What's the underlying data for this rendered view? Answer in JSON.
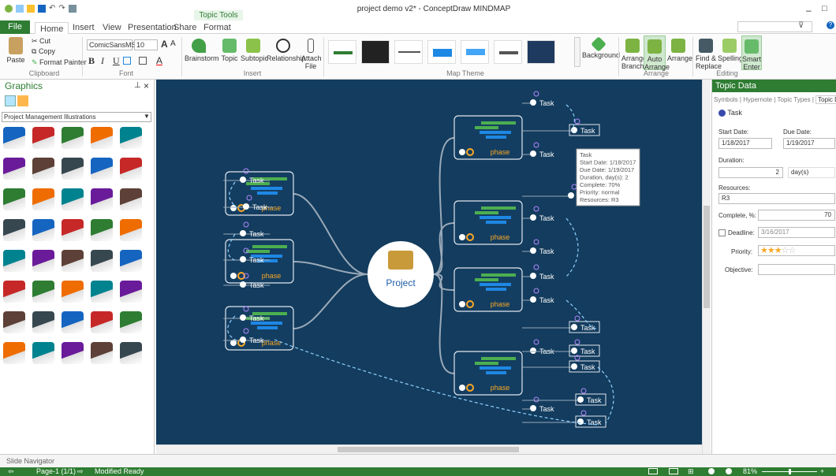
{
  "window": {
    "title": "project demo v2* - ConceptDraw MINDMAP",
    "context_tab": "Topic Tools",
    "search_value": "",
    "controls": [
      "–",
      "□"
    ]
  },
  "tabs": [
    {
      "id": "file",
      "label": "File"
    },
    {
      "id": "home",
      "label": "Home"
    },
    {
      "id": "insert",
      "label": "Insert"
    },
    {
      "id": "view",
      "label": "View"
    },
    {
      "id": "presentation",
      "label": "Presentation"
    },
    {
      "id": "share",
      "label": "Share"
    },
    {
      "id": "format",
      "label": "Format"
    }
  ],
  "ribbon": {
    "clipboard": {
      "paste": "Paste",
      "cut": "Cut",
      "copy": "Copy",
      "format_painter": "Format Painter",
      "label": "Clipboard"
    },
    "font": {
      "family": "ComicSansMS",
      "size": "10",
      "label": "Font",
      "bold": "B",
      "italic": "I",
      "underline": "U",
      "grow": "A",
      "shrink": "A"
    },
    "insert": {
      "brainstorm": "Brainstorm",
      "topic": "Topic",
      "subtopic": "Subtopic",
      "relationship": "Relationship",
      "attach": "Attach",
      "attach2": "File",
      "label": "Insert"
    },
    "theme": {
      "label": "Map Theme",
      "background": "Background"
    },
    "arrange": {
      "branch": "Arrange",
      "branch2": "Branch",
      "auto": "Auto",
      "auto2": "Arrange",
      "arrange": "Arrange",
      "label": "Arrange"
    },
    "editing": {
      "find": "Find &",
      "find2": "Replace",
      "spelling": "Spelling",
      "smart": "Smart",
      "smart2": "Enter",
      "label": "Editing"
    }
  },
  "left_panel": {
    "title": "Graphics",
    "category": "Project Management Illustrations",
    "pin": "📌",
    "close": "×",
    "item_count": 40
  },
  "right_panel": {
    "title": "Topic Data",
    "tabs": [
      "Symbols",
      "Hypernote",
      "Topic Types",
      "Topic Da"
    ],
    "task_name": "Task",
    "start_label": "Start Date:",
    "due_label": "Due Date:",
    "start": "1/18/2017",
    "due": "1/19/2017",
    "duration_label": "Duration:",
    "duration": "2",
    "duration_unit": "day(s)",
    "resources_label": "Resources:",
    "resources": "R3",
    "complete_label": "Complete, %:",
    "complete": "70",
    "deadline_label": "Deadline:",
    "deadline": "3/16/2017",
    "priority_label": "Priority:",
    "priority_stars": 3,
    "objective_label": "Objective:",
    "objective": ""
  },
  "map": {
    "center": "Project",
    "left_phase_label": "phase",
    "right_phase_label": "phase",
    "task_label": "Task",
    "tooltip": [
      "Task",
      "Start Date: 1/18/2017",
      "Due Date: 1/19/2017",
      "Duration, day(s): 2",
      "Complete: 70%",
      "Priority: normal",
      "Resources: R3"
    ]
  },
  "slide_navigator": "Slide Navigator",
  "status": {
    "page": "Page-1 (1/1)",
    "state": "Modified  Ready",
    "zoom": "81%"
  },
  "colors": {
    "accent": "#2e7d32",
    "canvas": "#133c5e"
  }
}
